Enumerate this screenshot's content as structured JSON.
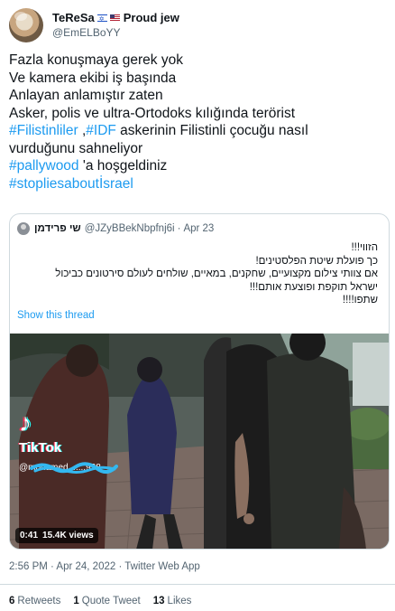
{
  "author": {
    "display_name": "TeReSa",
    "name_suffix": "Proud jew",
    "handle": "@EmELBoYY"
  },
  "tweet_lines": [
    [
      {
        "t": "Fazla konuşmaya gerek yok",
        "link": false
      }
    ],
    [
      {
        "t": "Ve kamera ekibi iş başında",
        "link": false
      }
    ],
    [
      {
        "t": "Anlayan anlamıştır zaten",
        "link": false
      }
    ],
    [
      {
        "t": "Asker, polis ve ultra-Ortodoks kılığında terörist",
        "link": false
      }
    ],
    [
      {
        "t": "#Filistinliler",
        "link": true
      },
      {
        "t": " ,",
        "link": false
      },
      {
        "t": "#IDF",
        "link": true
      },
      {
        "t": " askerinin Filistinli çocuğu nasıl",
        "link": false
      }
    ],
    [
      {
        "t": "vurduğunu sahneliyor",
        "link": false
      }
    ],
    [
      {
        "t": "#pallywood",
        "link": true
      },
      {
        "t": " 'a hoşgeldiniz",
        "link": false
      }
    ],
    [
      {
        "t": "#stopliesaboutİsrael",
        "link": true
      }
    ]
  ],
  "quoted_tweet": {
    "display_name": "שי פרידמן",
    "handle": "@JZyBBekNbpfnj6i",
    "separator": "·",
    "date": "Apr 23",
    "lines": [
      "הזווי!!!",
      "כך פועלת שיטת הפלסטינים!",
      "אם צוותי צילום מקצועיים, שחקנים, במאיים, שולחים לעולם סירטונים כביכול",
      "ישראל תוקפת ופוצעת אותם!!!",
      "שתפו!!!!"
    ],
    "show_thread_label": "Show this thread",
    "video": {
      "watermark": "TikTok",
      "watermark_user": "@mohamed.......938",
      "duration": "0:41",
      "views": "15.4K views"
    }
  },
  "timestamp": "2:56 PM · Apr 24, 2022 · Twitter Web App",
  "stats": [
    {
      "count": "6",
      "label": "Retweets"
    },
    {
      "count": "1",
      "label": "Quote Tweet"
    },
    {
      "count": "13",
      "label": "Likes"
    }
  ]
}
